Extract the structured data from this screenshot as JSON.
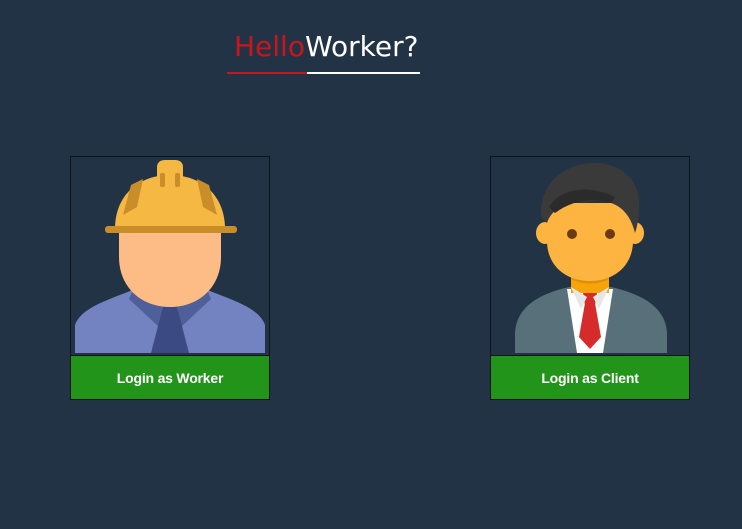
{
  "brand": {
    "hello": "Hello",
    "worker": "Worker?"
  },
  "cards": {
    "worker": {
      "button_label": "Login as Worker",
      "icon": "construction-worker-icon"
    },
    "client": {
      "button_label": "Login as Client",
      "icon": "businessman-icon"
    }
  },
  "colors": {
    "background": "#223345",
    "accent_red": "#c9161e",
    "button_green": "#23941a",
    "text_white": "#ffffff"
  }
}
